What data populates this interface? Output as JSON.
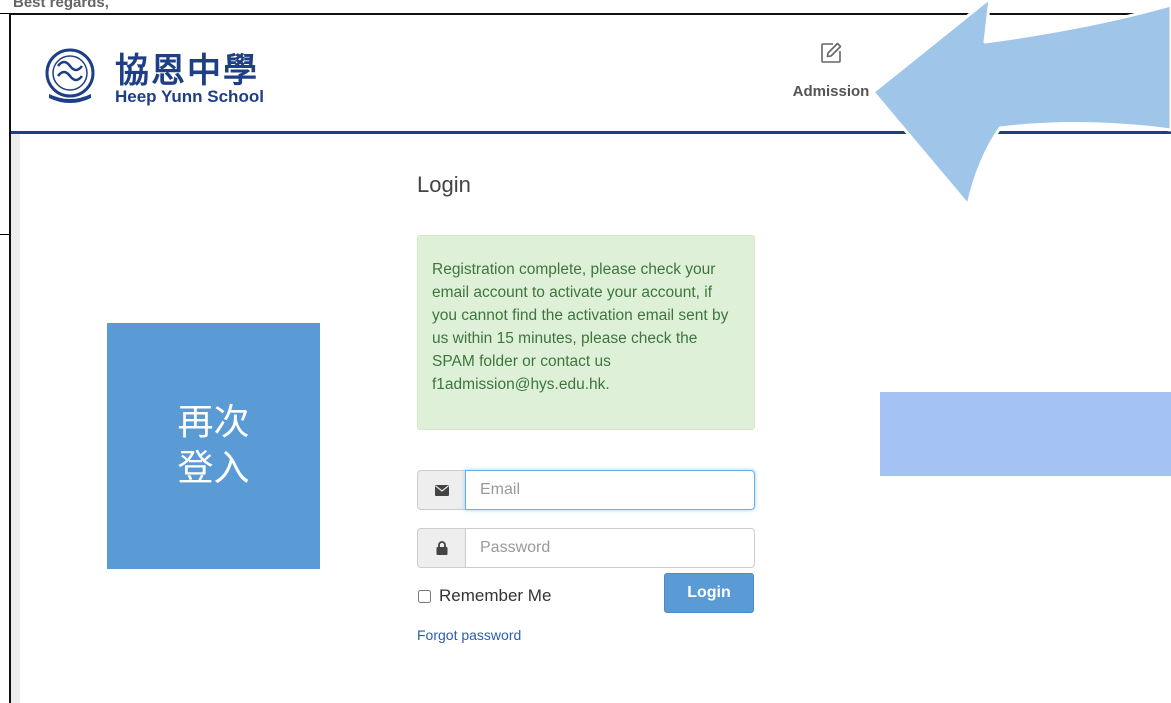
{
  "email_fragment": "Best regards,",
  "header": {
    "logo_cn": "協恩中學",
    "logo_en": "Heep Yunn School",
    "logo_emblem_text": "HEEP YUNN SCHOOL",
    "nav_admission_label": "Admission",
    "nav_admission_icon": "edit-icon"
  },
  "login": {
    "heading": "Login",
    "alert_text": "Registration complete, please check your email account to activate your account, if you cannot find the activation email sent by us within 15 minutes, please check the SPAM folder or contact us f1admission@hys.edu.hk.",
    "email_placeholder": "Email",
    "email_value": "",
    "email_icon": "envelope-icon",
    "password_placeholder": "Password",
    "password_value": "",
    "password_icon": "lock-icon",
    "remember_label": "Remember Me",
    "remember_checked": false,
    "login_button": "Login",
    "forgot_link": "Forgot password"
  },
  "annotations": {
    "callout_text": "再次登入",
    "arrow_color": "#9fc5e8",
    "callout_color": "#5b9bd5",
    "blank_box_color": "#a4c2f4"
  },
  "colors": {
    "brand_navy": "#1f3f84",
    "alert_bg": "#dff0d8",
    "alert_text": "#3c763d",
    "button_blue": "#5b9bd5"
  }
}
